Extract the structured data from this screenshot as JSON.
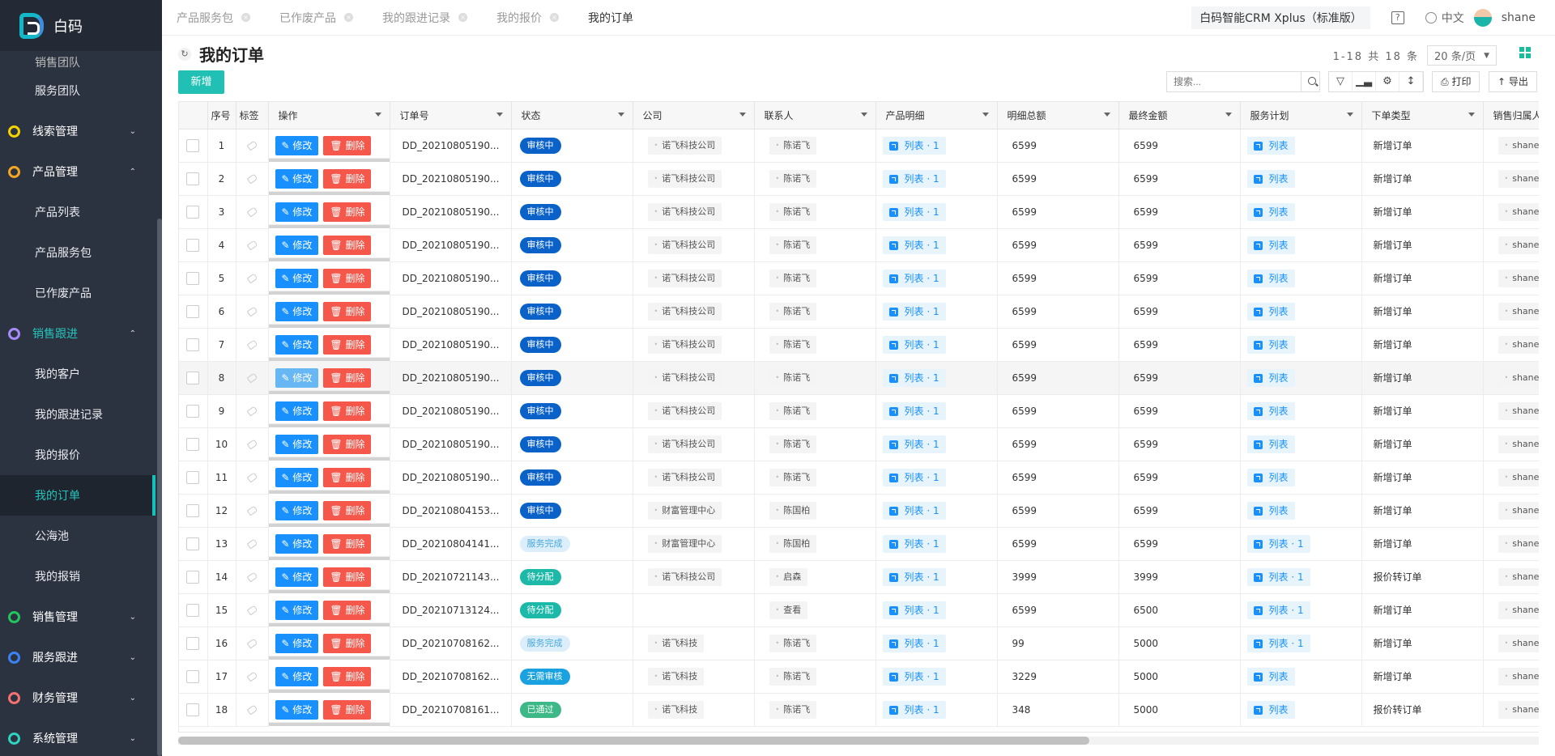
{
  "app": {
    "name": "白码"
  },
  "sidebar": {
    "top_partial": "销售团队",
    "items": [
      {
        "type": "sub",
        "label": "服务团队"
      },
      {
        "type": "group",
        "label": "线索管理",
        "dot": "#f5d300",
        "chev": "down"
      },
      {
        "type": "group",
        "label": "产品管理",
        "dot": "#f5a623",
        "chev": "up"
      },
      {
        "type": "sub",
        "label": "产品列表"
      },
      {
        "type": "sub",
        "label": "产品服务包"
      },
      {
        "type": "sub",
        "label": "已作废产品"
      },
      {
        "type": "group",
        "label": "销售跟进",
        "dot": "#a78bfa",
        "chev": "up",
        "open": true
      },
      {
        "type": "sub",
        "label": "我的客户"
      },
      {
        "type": "sub",
        "label": "我的跟进记录"
      },
      {
        "type": "sub",
        "label": "我的报价"
      },
      {
        "type": "sub",
        "label": "我的订单",
        "active": true
      },
      {
        "type": "sub",
        "label": "公海池"
      },
      {
        "type": "sub",
        "label": "我的报销"
      },
      {
        "type": "group",
        "label": "销售管理",
        "dot": "#22c55e",
        "chev": "down"
      },
      {
        "type": "group",
        "label": "服务跟进",
        "dot": "#3b82f6",
        "chev": "down"
      },
      {
        "type": "group",
        "label": "财务管理",
        "dot": "#f87171",
        "chev": "down"
      },
      {
        "type": "group",
        "label": "系统管理",
        "dot": "#2dd4bf",
        "chev": "down"
      }
    ]
  },
  "tabs": [
    {
      "label": "产品服务包"
    },
    {
      "label": "已作废产品"
    },
    {
      "label": "我的跟进记录"
    },
    {
      "label": "我的报价"
    },
    {
      "label": "我的订单",
      "active": true
    }
  ],
  "topbar": {
    "edition": "白码智能CRM Xplus（标准版）",
    "help": "?",
    "language": "中文",
    "user": "shane"
  },
  "page": {
    "title": "我的订单",
    "pager_text": "1-18 共 18 条",
    "page_size": "20 条/页",
    "new_button": "新增",
    "search_placeholder": "搜索...",
    "print_label": "打印",
    "export_label": "导出"
  },
  "table": {
    "columns": [
      "序号",
      "标签",
      "操作",
      "订单号",
      "状态",
      "公司",
      "联系人",
      "产品明细",
      "明细总额",
      "最终金额",
      "服务计划",
      "下单类型",
      "销售归属人"
    ],
    "edit_label": "修改",
    "delete_label": "删除",
    "rows": [
      {
        "no": "1",
        "order": "DD_20210805190...",
        "status": "审核中",
        "st": "blue",
        "company": "诺飞科技公司",
        "contact": "陈诺飞",
        "detail": "列表 · 1",
        "total": "6599",
        "final": "6599",
        "plan": "列表",
        "type": "新增订单",
        "owner": "shane"
      },
      {
        "no": "2",
        "order": "DD_20210805190...",
        "status": "审核中",
        "st": "blue",
        "company": "诺飞科技公司",
        "contact": "陈诺飞",
        "detail": "列表 · 1",
        "total": "6599",
        "final": "6599",
        "plan": "列表",
        "type": "新增订单",
        "owner": "shane"
      },
      {
        "no": "3",
        "order": "DD_20210805190...",
        "status": "审核中",
        "st": "blue",
        "company": "诺飞科技公司",
        "contact": "陈诺飞",
        "detail": "列表 · 1",
        "total": "6599",
        "final": "6599",
        "plan": "列表",
        "type": "新增订单",
        "owner": "shane"
      },
      {
        "no": "4",
        "order": "DD_20210805190...",
        "status": "审核中",
        "st": "blue",
        "company": "诺飞科技公司",
        "contact": "陈诺飞",
        "detail": "列表 · 1",
        "total": "6599",
        "final": "6599",
        "plan": "列表",
        "type": "新增订单",
        "owner": "shane"
      },
      {
        "no": "5",
        "order": "DD_20210805190...",
        "status": "审核中",
        "st": "blue",
        "company": "诺飞科技公司",
        "contact": "陈诺飞",
        "detail": "列表 · 1",
        "total": "6599",
        "final": "6599",
        "plan": "列表",
        "type": "新增订单",
        "owner": "shane"
      },
      {
        "no": "6",
        "order": "DD_20210805190...",
        "status": "审核中",
        "st": "blue",
        "company": "诺飞科技公司",
        "contact": "陈诺飞",
        "detail": "列表 · 1",
        "total": "6599",
        "final": "6599",
        "plan": "列表",
        "type": "新增订单",
        "owner": "shane"
      },
      {
        "no": "7",
        "order": "DD_20210805190...",
        "status": "审核中",
        "st": "blue",
        "company": "诺飞科技公司",
        "contact": "陈诺飞",
        "detail": "列表 · 1",
        "total": "6599",
        "final": "6599",
        "plan": "列表",
        "type": "新增订单",
        "owner": "shane"
      },
      {
        "no": "8",
        "order": "DD_20210805190...",
        "status": "审核中",
        "st": "blue",
        "company": "诺飞科技公司",
        "contact": "陈诺飞",
        "detail": "列表 · 1",
        "total": "6599",
        "final": "6599",
        "plan": "列表",
        "type": "新增订单",
        "owner": "shane",
        "hover": true
      },
      {
        "no": "9",
        "order": "DD_20210805190...",
        "status": "审核中",
        "st": "blue",
        "company": "诺飞科技公司",
        "contact": "陈诺飞",
        "detail": "列表 · 1",
        "total": "6599",
        "final": "6599",
        "plan": "列表",
        "type": "新增订单",
        "owner": "shane"
      },
      {
        "no": "10",
        "order": "DD_20210805190...",
        "status": "审核中",
        "st": "blue",
        "company": "诺飞科技公司",
        "contact": "陈诺飞",
        "detail": "列表 · 1",
        "total": "6599",
        "final": "6599",
        "plan": "列表",
        "type": "新增订单",
        "owner": "shane"
      },
      {
        "no": "11",
        "order": "DD_20210805190...",
        "status": "审核中",
        "st": "blue",
        "company": "诺飞科技公司",
        "contact": "陈诺飞",
        "detail": "列表 · 1",
        "total": "6599",
        "final": "6599",
        "plan": "列表",
        "type": "新增订单",
        "owner": "shane"
      },
      {
        "no": "12",
        "order": "DD_20210804153...",
        "status": "审核中",
        "st": "blue",
        "company": "财富管理中心",
        "contact": "陈国柏",
        "detail": "列表 · 1",
        "total": "6599",
        "final": "6599",
        "plan": "列表",
        "type": "新增订单",
        "owner": "shane"
      },
      {
        "no": "13",
        "order": "DD_20210804141...",
        "status": "服务完成",
        "st": "lightblue",
        "company": "财富管理中心",
        "contact": "陈国柏",
        "detail": "列表 · 1",
        "total": "6599",
        "final": "6599",
        "plan": "列表 · 1",
        "type": "新增订单",
        "owner": "shane"
      },
      {
        "no": "14",
        "order": "DD_20210721143...",
        "status": "待分配",
        "st": "teal",
        "company": "诺飞科技公司",
        "contact": "启森",
        "detail": "列表 · 1",
        "total": "3999",
        "final": "3999",
        "plan": "列表 · 1",
        "type": "报价转订单",
        "owner": "shane"
      },
      {
        "no": "15",
        "order": "DD_20210713124...",
        "status": "待分配",
        "st": "teal",
        "company": "",
        "contact": "查看",
        "detail": "列表 · 1",
        "total": "6599",
        "final": "6500",
        "plan": "列表 · 1",
        "type": "新增订单",
        "owner": "shane"
      },
      {
        "no": "16",
        "order": "DD_20210708162...",
        "status": "服务完成",
        "st": "lightblue",
        "company": "诺飞科技",
        "contact": "陈诺飞",
        "detail": "列表 · 1",
        "total": "99",
        "final": "5000",
        "plan": "列表 · 1",
        "type": "新增订单",
        "owner": "shane"
      },
      {
        "no": "17",
        "order": "DD_20210708162...",
        "status": "无需审核",
        "st": "cyan",
        "company": "诺飞科技",
        "contact": "陈诺飞",
        "detail": "列表 · 1",
        "total": "3229",
        "final": "5000",
        "plan": "列表",
        "type": "新增订单",
        "owner": "shane"
      },
      {
        "no": "18",
        "order": "DD_20210708161...",
        "status": "已通过",
        "st": "green",
        "company": "诺飞科技",
        "contact": "陈诺飞",
        "detail": "列表 · 1",
        "total": "348",
        "final": "5000",
        "plan": "列表",
        "type": "报价转订单",
        "owner": "shane"
      }
    ]
  },
  "colors": {
    "accent": "#20c0b5",
    "edit": "#1890ff",
    "delete": "#f5574a",
    "sidebar": "#2c3340"
  }
}
